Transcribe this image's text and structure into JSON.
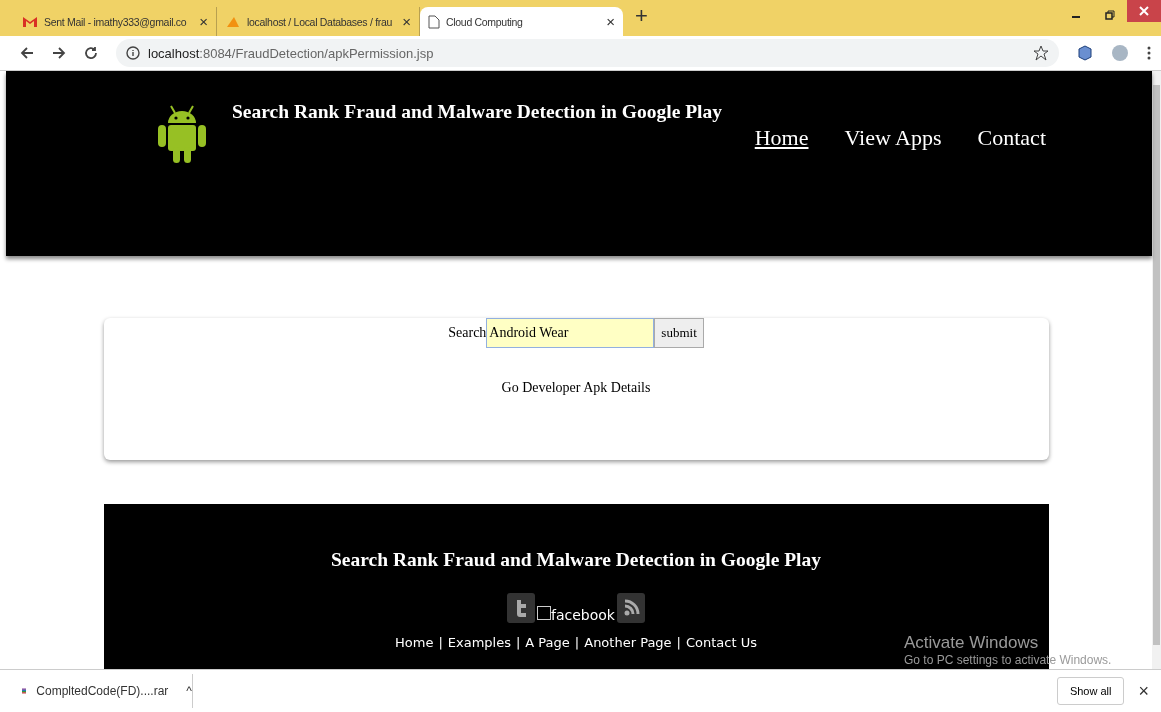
{
  "browser": {
    "tabs": [
      {
        "title": "Sent Mail - imathy333@gmail.co",
        "close": "×",
        "selected": false
      },
      {
        "title": "localhost / Local Databases / frau",
        "close": "×",
        "selected": false
      },
      {
        "title": "Cloud Computing",
        "close": "×",
        "selected": true
      }
    ],
    "new_tab": "+",
    "url_host": "localhost",
    "url_rest": ":8084/FraudDetection/apkPermission.jsp"
  },
  "header": {
    "title": "Search Rank Fraud and Malware Detection in Google Play",
    "nav": [
      {
        "label": "Home",
        "selected": true
      },
      {
        "label": "View Apps",
        "selected": false
      },
      {
        "label": "Contact",
        "selected": false
      }
    ]
  },
  "search": {
    "label": "Search",
    "value": "Android Wear",
    "button": "submit",
    "link": "Go Developer Apk Details"
  },
  "footer": {
    "title": "Search Rank Fraud and Malware Detection in Google Play",
    "facebook": "facebook",
    "links": [
      "Home",
      "Examples",
      "A Page",
      "Another Page",
      "Contact Us"
    ],
    "separator": "|"
  },
  "watermark": {
    "title": "Activate Windows",
    "subtitle": "Go to PC settings to activate Windows."
  },
  "downloads": {
    "file": "CompltedCode(FD)....rar",
    "caret": "^",
    "show_all": "Show all",
    "close": "×"
  }
}
